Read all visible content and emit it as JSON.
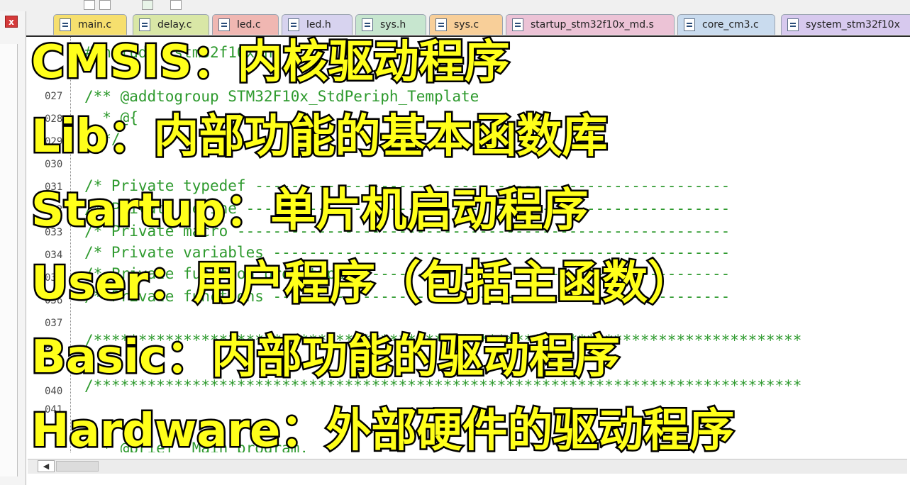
{
  "tabs": [
    {
      "label": "main.c",
      "color": "#f6df6e"
    },
    {
      "label": "delay.c",
      "color": "#d9e7a6"
    },
    {
      "label": "led.c",
      "color": "#f0b7b2"
    },
    {
      "label": "led.h",
      "color": "#d7d3ef"
    },
    {
      "label": "sys.h",
      "color": "#c7e6cf"
    },
    {
      "label": "sys.c",
      "color": "#f8cf99"
    },
    {
      "label": "startup_stm32f10x_md.s",
      "color": "#ecc3d6"
    },
    {
      "label": "core_cm3.c",
      "color": "#c9dbee"
    },
    {
      "label": "system_stm32f10x",
      "color": "#d7c9ee"
    }
  ],
  "close_label": "x",
  "line_numbers": [
    "027",
    "028",
    "029",
    "030",
    "031",
    "032",
    "033",
    "034",
    "035",
    "036",
    "037",
    "038",
    "039",
    "040",
    "041"
  ],
  "code_lines": [
    "#include \"stm32f10x.h\"",
    "/** @addtogroup STM32F10x_StdPeriph_Template",
    "  * @{",
    "  */",
    "",
    "/* Private typedef -----------------------------------------------------",
    "/* Private define ------------------------------------------------------",
    "/* Private macro -------------------------------------------------------",
    "/* Private variables ---------------------------------------------------",
    "/* Private function prototypes -----------------------------------------",
    "/* Private functions ---------------------------------------------------",
    "",
    "/*******************************************************************************",
    "",
    "/*******************************************************************************",
    "",
    "  * @brief  Main program."
  ],
  "overlay_lines": [
    "CMSIS：内核驱动程序",
    "Lib：内部功能的基本函数库",
    "Startup：单片机启动程序",
    "User：用户程序（包括主函数）",
    "Basic：内部功能的驱动程序",
    "Hardware：外部硬件的驱动程序"
  ],
  "overlay_color": "#ffff1a",
  "code_color": "#2e9a2e",
  "scroll_left_arrow": "◀"
}
